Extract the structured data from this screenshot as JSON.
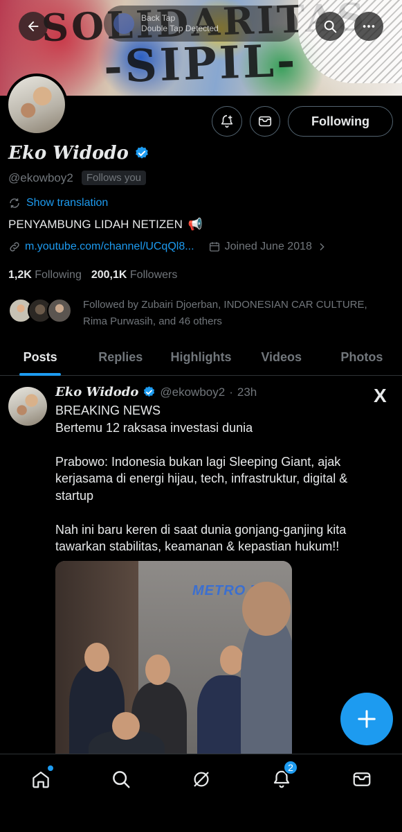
{
  "header": {
    "back_label": "Back",
    "overlay_line1": "Back Tap",
    "overlay_line2": "Double Tap Detected",
    "banner_text_1": "SOLIDARITAS",
    "banner_text_2": "-SIPIL-"
  },
  "profile": {
    "name": "Eko Widodo",
    "handle": "@ekowboy2",
    "follows_you": "Follows you",
    "show_translation": "Show translation",
    "bio": "PENYAMBUNG LIDAH NETIZEN",
    "bio_emoji": "📢",
    "link": "m.youtube.com/channel/UCqQl8...",
    "joined": "Joined June 2018",
    "following_count": "1,2K",
    "following_label": "Following",
    "followers_count": "200,1K",
    "followers_label": "Followers",
    "followed_by": "Followed by Zubairi Djoerban, INDONESIAN CAR CULTURE, Rima Purwasih, and 46 others",
    "following_button": "Following"
  },
  "tabs": [
    "Posts",
    "Replies",
    "Highlights",
    "Videos",
    "Photos"
  ],
  "active_tab": "Posts",
  "post": {
    "name": "Eko Widodo",
    "handle": "@ekowboy2",
    "separator": "·",
    "time": "23h",
    "text": "BREAKING NEWS\nBertemu 12 raksasa investasi dunia\n\nPrabowo: Indonesia bukan lagi Sleeping Giant, ajak kerjasama di energi hijau, tech, infrastruktur, digital & startup\n\nNah ini baru keren di saat dunia gonjang-ganjing kita tawarkan stabilitas, keamanan & kepastian hukum!!",
    "media_watermark": "METRO TV",
    "source_logo": "X"
  },
  "fab_label": "+",
  "bottom_nav": {
    "notifications_badge": "2"
  },
  "colors": {
    "accent": "#1d9bf0",
    "background": "#000000",
    "text_primary": "#e7e9ea",
    "text_secondary": "#71767b"
  }
}
